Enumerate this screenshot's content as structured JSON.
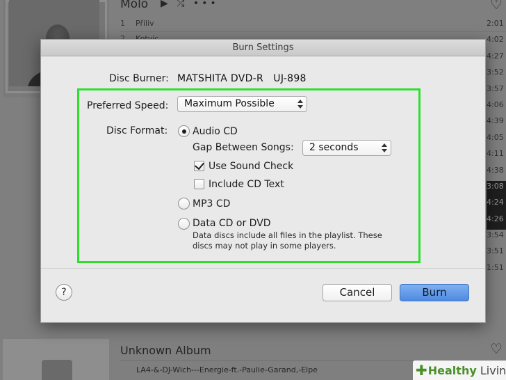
{
  "background": {
    "album_title": "Molo",
    "album_controls": "▶ ⤮ •••",
    "heart_icon": "♡",
    "tracks": [
      {
        "num": "1",
        "name": "Přiliv"
      },
      {
        "num": "2",
        "name": "Kotvic"
      }
    ],
    "durations": [
      "2:01",
      "4:02",
      "4:27",
      "3:52",
      "3:57",
      "4:06",
      "4:39",
      "4:05",
      "4:11",
      "4:38",
      "3:08",
      "4:24",
      "4:26",
      "3:54",
      "3:51",
      "1:51"
    ],
    "album2_title": "Unknown Album",
    "album2_track": "LA4-&-DJ-Wich---Energie-ft.-Paulie-Garand,-Elpe"
  },
  "dialog": {
    "title": "Burn Settings",
    "disc_burner_label": "Disc Burner:",
    "disc_burner_value": "MATSHITA DVD-R   UJ-898",
    "preferred_speed_label": "Preferred Speed:",
    "preferred_speed_value": "Maximum Possible",
    "disc_format_label": "Disc Format:",
    "formats": {
      "audio_cd": {
        "label": "Audio CD",
        "selected": true
      },
      "mp3_cd": {
        "label": "MP3 CD",
        "selected": false
      },
      "data_cd": {
        "label": "Data CD or DVD",
        "selected": false
      }
    },
    "gap_label": "Gap Between Songs:",
    "gap_value": "2 seconds",
    "use_sound_check": {
      "label": "Use Sound Check",
      "checked": true
    },
    "include_cd_text": {
      "label": "Include CD Text",
      "checked": false
    },
    "data_note": "Data discs include all files in the playlist.  These discs may not play in some players.",
    "help_label": "?",
    "cancel_label": "Cancel",
    "burn_label": "Burn"
  },
  "watermark": {
    "word1": "Healthy",
    "word2": "Living"
  },
  "colors": {
    "highlight_box": "#2ee02e",
    "primary_button": "#5a93e4"
  }
}
